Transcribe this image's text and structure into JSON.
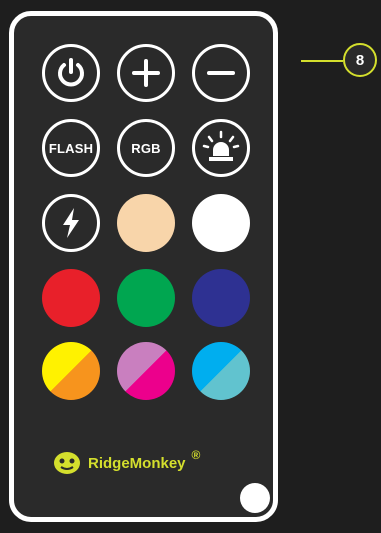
{
  "remote": {
    "buttons": {
      "flash_label": "FLASH",
      "rgb_label": "RGB"
    },
    "colors": {
      "warm_white": "#f8d5aa",
      "white": "#ffffff",
      "red": "#e8202a",
      "green": "#00a650",
      "blue": "#2e3192",
      "split1": [
        "#f7941d",
        "#fff200"
      ],
      "split2": [
        "#ec008c",
        "#c97fbf"
      ],
      "split3": [
        "#61c3cf",
        "#00aeef"
      ],
      "brand": "#d4df2d"
    },
    "brand": {
      "name": "RidgeMonkey",
      "reg": "®",
      "icon": "monkey-logo-icon"
    }
  },
  "callout": {
    "number": "8"
  }
}
